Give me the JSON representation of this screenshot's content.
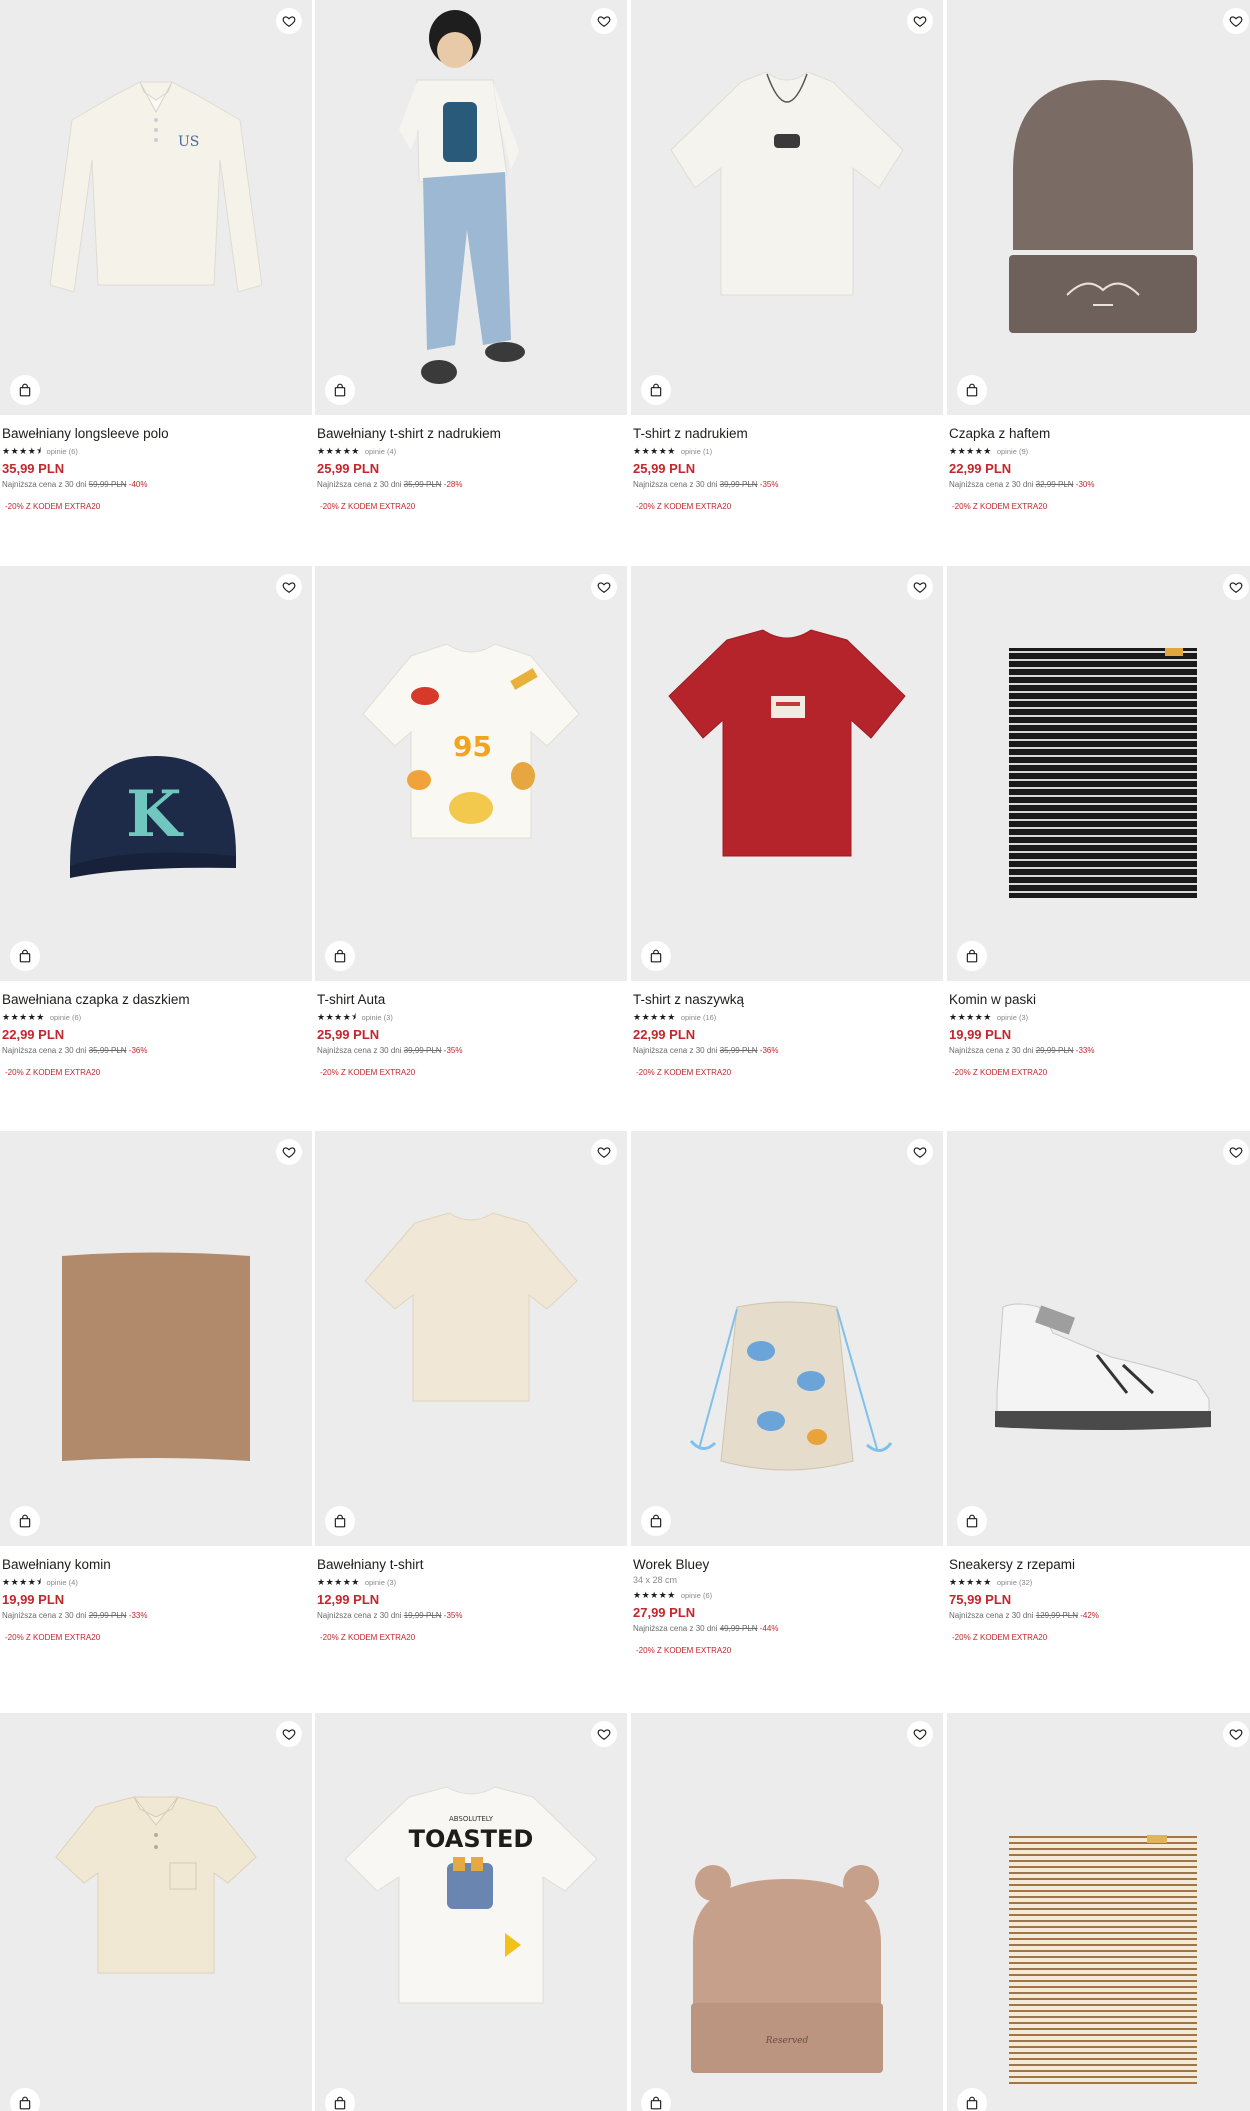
{
  "products": [
    {
      "name": "Bawełniany longsleeve polo",
      "stars": "★★★★⯨",
      "reviews": "opinie (6)",
      "price": "35,99 PLN",
      "lowest_label": "Najniższa cena z 30 dni",
      "old_price": "59,99 PLN",
      "discount": "-40%",
      "code_text": "-20% Z KODEM EXTRA20",
      "icon": "polo-longsleeve"
    },
    {
      "name": "Bawełniany t-shirt z nadrukiem",
      "stars": "★★★★★",
      "reviews": "opinie (4)",
      "price": "25,99 PLN",
      "lowest_label": "Najniższa cena z 30 dni",
      "old_price": "35,99 PLN",
      "discount": "-28%",
      "code_text": "-20% Z KODEM EXTRA20",
      "icon": "kid-model"
    },
    {
      "name": "T-shirt z nadrukiem",
      "stars": "★★★★★",
      "reviews": "opinie (1)",
      "price": "25,99 PLN",
      "lowest_label": "Najniższa cena z 30 dni",
      "old_price": "39,99 PLN",
      "discount": "-35%",
      "code_text": "-20% Z KODEM EXTRA20",
      "icon": "tshirt-necklace"
    },
    {
      "name": "Czapka z haftem",
      "stars": "★★★★★",
      "reviews": "opinie (9)",
      "price": "22,99 PLN",
      "lowest_label": "Najniższa cena z 30 dni",
      "old_price": "32,99 PLN",
      "discount": "-30%",
      "code_text": "-20% Z KODEM EXTRA20",
      "icon": "beanie"
    },
    {
      "name": "Bawełniana czapka z daszkiem",
      "stars": "★★★★★",
      "reviews": "opinie (6)",
      "price": "22,99 PLN",
      "lowest_label": "Najniższa cena z 30 dni",
      "old_price": "35,99 PLN",
      "discount": "-36%",
      "code_text": "-20% Z KODEM EXTRA20",
      "icon": "baseball-cap"
    },
    {
      "name": "T-shirt Auta",
      "stars": "★★★★⯨",
      "reviews": "opinie (3)",
      "price": "25,99 PLN",
      "lowest_label": "Najniższa cena z 30 dni",
      "old_price": "39,99 PLN",
      "discount": "-35%",
      "code_text": "-20% Z KODEM EXTRA20",
      "icon": "tshirt-cars"
    },
    {
      "name": "T-shirt z naszywką",
      "stars": "★★★★★",
      "reviews": "opinie (16)",
      "price": "22,99 PLN",
      "lowest_label": "Najniższa cena z 30 dni",
      "old_price": "35,99 PLN",
      "discount": "-36%",
      "code_text": "-20% Z KODEM EXTRA20",
      "icon": "tshirt-red"
    },
    {
      "name": "Komin w paski",
      "stars": "★★★★★",
      "reviews": "opinie (3)",
      "price": "19,99 PLN",
      "lowest_label": "Najniższa cena z 30 dni",
      "old_price": "29,99 PLN",
      "discount": "-33%",
      "code_text": "-20% Z KODEM EXTRA20",
      "icon": "snood-striped"
    },
    {
      "name": "Bawełniany komin",
      "stars": "★★★★⯨",
      "reviews": "opinie (4)",
      "price": "19,99 PLN",
      "lowest_label": "Najniższa cena z 30 dni",
      "old_price": "29,99 PLN",
      "discount": "-33%",
      "code_text": "-20% Z KODEM EXTRA20",
      "icon": "snood-brown"
    },
    {
      "name": "Bawełniany t-shirt",
      "stars": "★★★★★",
      "reviews": "opinie (3)",
      "price": "12,99 PLN",
      "lowest_label": "Najniższa cena z 30 dni",
      "old_price": "19,99 PLN",
      "discount": "-35%",
      "code_text": "-20% Z KODEM EXTRA20",
      "icon": "tshirt-cream"
    },
    {
      "name": "Worek Bluey",
      "subtitle": "34 x 28 cm",
      "stars": "★★★★★",
      "reviews": "opinie (6)",
      "price": "27,99 PLN",
      "lowest_label": "Najniższa cena z 30 dni",
      "old_price": "49,99 PLN",
      "discount": "-44%",
      "code_text": "-20% Z KODEM EXTRA20",
      "icon": "drawstring-bag"
    },
    {
      "name": "Sneakersy z rzepami",
      "stars": "★★★★★",
      "reviews": "opinie (32)",
      "price": "75,99 PLN",
      "lowest_label": "Najniższa cena z 30 dni",
      "old_price": "129,99 PLN",
      "discount": "-42%",
      "code_text": "-20% Z KODEM EXTRA20",
      "icon": "sneaker"
    },
    {
      "icon": "polo-shirt"
    },
    {
      "icon": "tshirt-toasted",
      "print_small": "ABSOLUTELY",
      "print_big": "TOASTED"
    },
    {
      "icon": "beanie-ears",
      "label_text": "Reserved"
    },
    {
      "icon": "snood-striped-tan"
    }
  ]
}
